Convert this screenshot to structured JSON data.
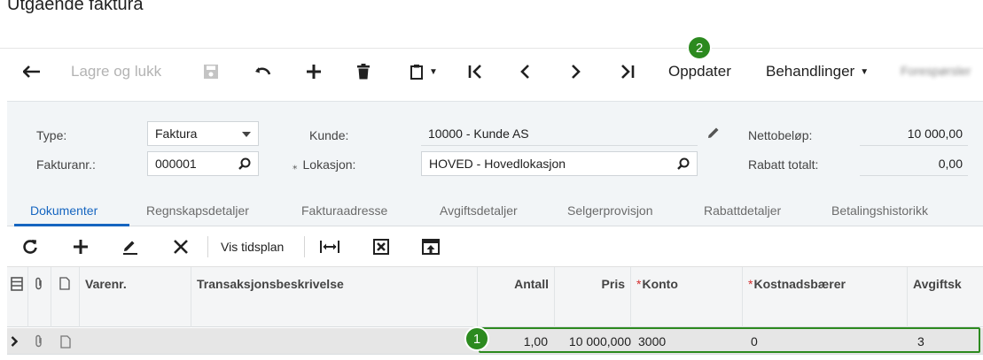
{
  "page": {
    "title": "Utgående faktura"
  },
  "toolbar": {
    "save_close": "Lagre og lukk",
    "refresh": "Oppdater",
    "actions": "Behandlinger",
    "blurred_item": "Forespørsler"
  },
  "callouts": {
    "one": "1",
    "two": "2"
  },
  "form": {
    "type_label": "Type:",
    "type_value": "Faktura",
    "invoice_no_label": "Fakturanr.:",
    "invoice_no_value": "000001",
    "customer_label": "Kunde:",
    "customer_value": "10000 - Kunde AS",
    "location_label": "Lokasjon:",
    "location_value": "HOVED - Hovedlokasjon",
    "net_amount_label": "Nettobeløp:",
    "net_amount_value": "10 000,00",
    "discount_total_label": "Rabatt totalt:",
    "discount_total_value": "0,00"
  },
  "tabs": [
    {
      "label": "Dokumenter"
    },
    {
      "label": "Regnskapsdetaljer"
    },
    {
      "label": "Fakturaadresse"
    },
    {
      "label": "Avgiftsdetaljer"
    },
    {
      "label": "Selgerprovisjon"
    },
    {
      "label": "Rabattdetaljer"
    },
    {
      "label": "Betalingshistorikk"
    }
  ],
  "grid_toolbar": {
    "schedule": "Vis tidsplan"
  },
  "grid": {
    "columns": {
      "item_no": "Varenr.",
      "description": "Transaksjonsbeskrivelse",
      "quantity": "Antall",
      "price": "Pris",
      "account": "Konto",
      "cost_center": "Kostnadsbærer",
      "tax": "Avgiftsk"
    },
    "required_mark": "*",
    "rows": [
      {
        "quantity": "1,00",
        "price": "10 000,000",
        "account": "3000",
        "cost_center": "0",
        "tax": "3"
      }
    ]
  },
  "colors": {
    "accent": "#1565c0",
    "callout": "#2c8a1f",
    "required": "#d32f2f"
  }
}
